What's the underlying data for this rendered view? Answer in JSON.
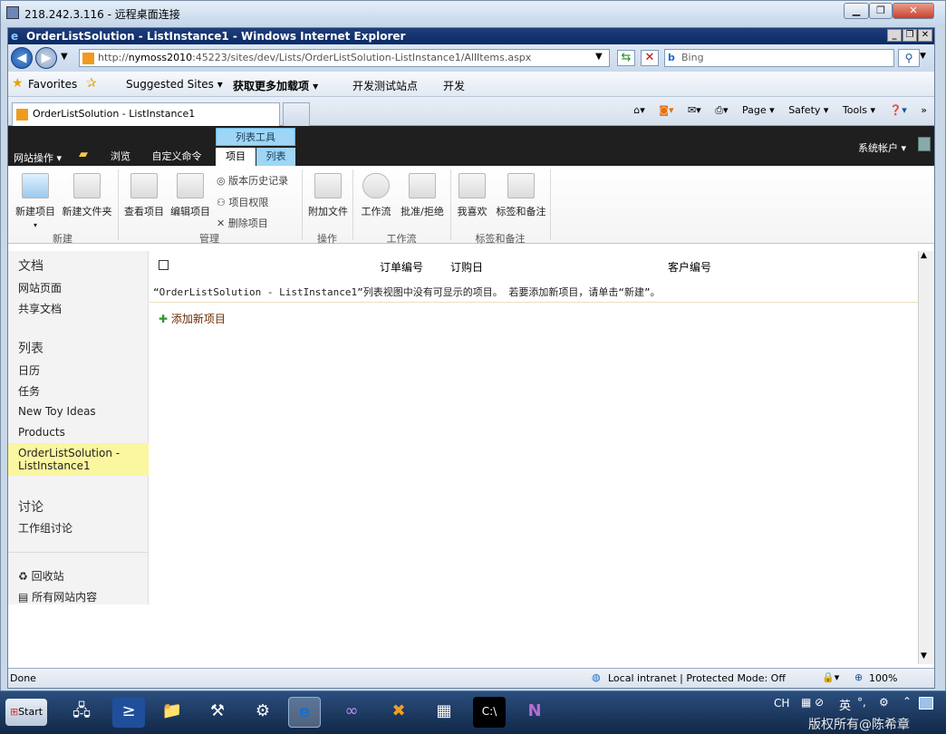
{
  "rdp": {
    "title": "218.242.3.116 - 远程桌面连接"
  },
  "ie": {
    "title": "OrderListSolution - ListInstance1 - Windows Internet Explorer",
    "url_prefix": "http://",
    "url_host": "nymoss2010",
    "url_rest": ":45223/sites/dev/Lists/OrderListSolution-ListInstance1/AllItems.aspx",
    "search_placeholder": "Bing",
    "favorites": {
      "label": "Favorites",
      "items": [
        "Suggested Sites ▾",
        "获取更多加载项 ▾",
        "开发测试站点",
        "开发"
      ]
    },
    "tab_label": "OrderListSolution - ListInstance1",
    "commands": [
      "Page ▾",
      "Safety ▾",
      "Tools ▾"
    ]
  },
  "sp": {
    "site_actions": "网站操作 ▾",
    "tab_browse": "浏览",
    "tab_custom": "自定义命令",
    "tools_group": "列表工具",
    "tab_items": "项目",
    "tab_list": "列表",
    "user": "系统帐户 ▾",
    "ribbon": {
      "new_item": "新建项目",
      "new_folder": "新建文件夹",
      "view_item": "查看项目",
      "edit_item": "编辑项目",
      "version_history": "版本历史记录",
      "item_permissions": "项目权限",
      "delete_item": "删除项目",
      "attach_file": "附加文件",
      "workflow": "工作流",
      "approve": "批准/拒绝",
      "like": "我喜欢",
      "tags": "标签和备注",
      "groups": {
        "new": "新建",
        "manage": "管理",
        "actions": "操作",
        "workflow": "工作流",
        "tags": "标签和备注"
      }
    },
    "nav": {
      "docs_header": "文档",
      "site_pages": "网站页面",
      "shared_docs": "共享文档",
      "lists_header": "列表",
      "calendar": "日历",
      "tasks": "任务",
      "toy": "New Toy Ideas",
      "products": "Products",
      "selected": "OrderListSolution - ListInstance1",
      "disc_header": "讨论",
      "team_disc": "工作组讨论",
      "recycle": "回收站",
      "all_content": "所有网站内容"
    },
    "list": {
      "col_order_no": "订单编号",
      "col_order_date": "订购日",
      "col_customer": "客户编号",
      "empty_msg": "“OrderListSolution - ListInstance1”列表视图中没有可显示的项目。 若要添加新项目，请单击“新建”。",
      "add_new": "添加新项目"
    }
  },
  "status": {
    "done": "Done",
    "zone": "Local intranet | Protected Mode: Off",
    "zoom": "100%"
  },
  "taskbar": {
    "start": "Start",
    "lang": "CH",
    "ime": "英",
    "watermark": "版权所有@陈希章"
  }
}
